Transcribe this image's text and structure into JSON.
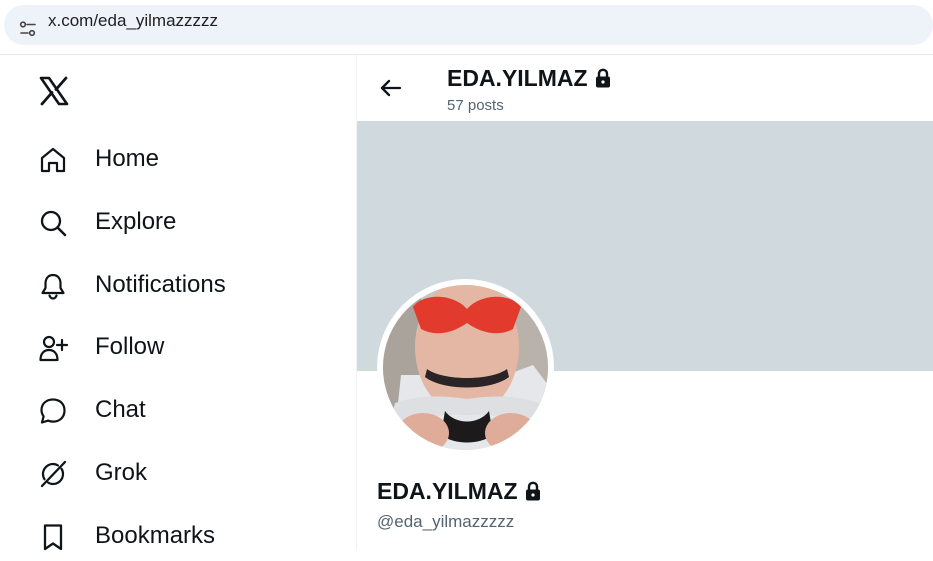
{
  "browser": {
    "url": "x.com/eda_yilmazzzzz",
    "site_info_icon": "tune-icon"
  },
  "sidebar": {
    "logo_icon": "x-logo-icon",
    "items": [
      {
        "label": "Home",
        "icon": "home-icon"
      },
      {
        "label": "Explore",
        "icon": "search-icon"
      },
      {
        "label": "Notifications",
        "icon": "bell-icon"
      },
      {
        "label": "Follow",
        "icon": "person-plus-icon"
      },
      {
        "label": "Chat",
        "icon": "chat-bubble-icon"
      },
      {
        "label": "Grok",
        "icon": "grok-icon"
      },
      {
        "label": "Bookmarks",
        "icon": "bookmark-icon"
      }
    ]
  },
  "profile_header": {
    "back_icon": "arrow-left-icon",
    "name": "EDA.YILMAZ",
    "posts_count": "57 posts",
    "locked_icon": "lock-icon"
  },
  "profile": {
    "banner_color": "#cfd9de",
    "avatar": "profile-photo",
    "name": "EDA.YILMAZ",
    "handle": "@eda_yilmazzzzz",
    "locked_icon": "lock-icon"
  }
}
